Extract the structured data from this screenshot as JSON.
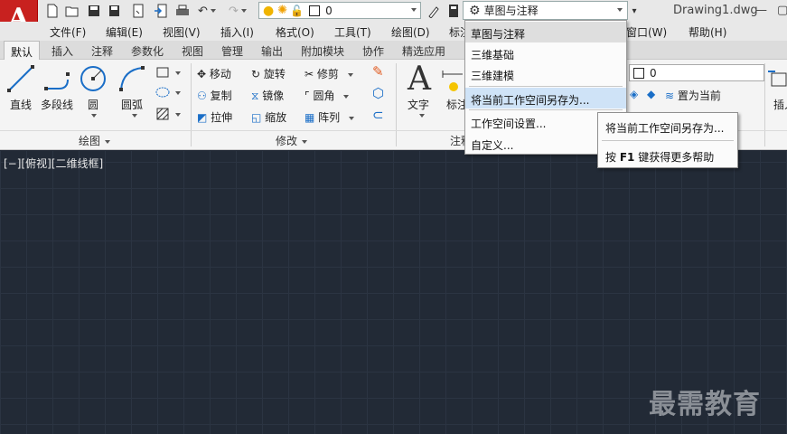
{
  "app": {
    "logo_letter": "A",
    "doc_title": "Drawing1.dwg"
  },
  "qat": {
    "layer_value": "0",
    "workspace_value": "草图与注释"
  },
  "window_controls": {
    "minimize": "—",
    "restore": "▢"
  },
  "menubar": [
    "文件(F)",
    "编辑(E)",
    "视图(V)",
    "插入(I)",
    "格式(O)",
    "工具(T)",
    "绘图(D)",
    "标注",
    "窗口(W)",
    "帮助(H)"
  ],
  "tabs": {
    "items": [
      "默认",
      "插入",
      "注释",
      "参数化",
      "视图",
      "管理",
      "输出",
      "附加模块",
      "协作",
      "精选应用"
    ],
    "active": "默认"
  },
  "ribbon": {
    "draw": {
      "line": "直线",
      "polyline": "多段线",
      "circle": "圆",
      "arc": "圆弧",
      "title": "绘图"
    },
    "modify": {
      "move": "移动",
      "rotate": "旋转",
      "trim": "修剪",
      "copy": "复制",
      "mirror": "镜像",
      "fillet": "圆角",
      "stretch": "拉伸",
      "scale": "缩放",
      "array": "阵列",
      "title": "修改"
    },
    "annotation": {
      "text": "文字",
      "dimension": "标注",
      "title": "注释"
    },
    "layers": {
      "layer_value": "0",
      "set_current": "置为当前"
    },
    "insert": {
      "label": "插入"
    }
  },
  "viewport": {
    "label": "[−][俯视][二维线框]"
  },
  "workspace_menu": {
    "items": [
      "草图与注释",
      "三维基础",
      "三维建模"
    ],
    "save_as": "将当前工作空间另存为...",
    "settings": "工作空间设置...",
    "customize": "自定义..."
  },
  "tooltip": {
    "title": "将当前工作空间另存为...",
    "help_prefix": "按 ",
    "help_key": "F1",
    "help_suffix": " 键获得更多帮助"
  },
  "watermark": "最需教育",
  "colors": {
    "accent_red": "#c8211f",
    "canvas": "#222a36",
    "hover": "#cfe3f7"
  }
}
